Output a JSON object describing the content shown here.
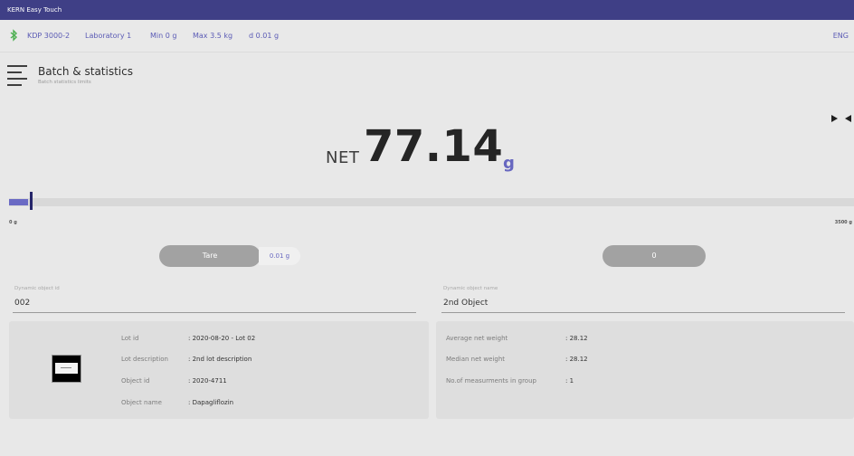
{
  "app": {
    "title": "KERN Easy Touch"
  },
  "status_bar": {
    "model": "KDP 3000-2",
    "location": "Laboratory 1",
    "min": "Min 0 g",
    "max": "Max 3.5 kg",
    "d": "d 0.01 g",
    "language": "ENG"
  },
  "page": {
    "title": "Batch & statistics",
    "subtitle": "Batch statistics limits"
  },
  "reading": {
    "net_label": "NET",
    "value": "77.14",
    "unit": "g"
  },
  "range_bar": {
    "min_label": "0 g",
    "max_label": "3500 g",
    "fill_fraction": 0.022
  },
  "buttons": {
    "tare": "Tare",
    "tare_value": "0.01 g",
    "zero": "0"
  },
  "fields": {
    "object_id": {
      "label": "Dynamic object id",
      "value": "002"
    },
    "object_name": {
      "label": "Dynamic object name",
      "value": "2nd Object"
    }
  },
  "object_details": [
    {
      "key": "Lot id",
      "value": ": 2020-08-20 - Lot 02"
    },
    {
      "key": "Lot description",
      "value": ": 2nd lot description"
    },
    {
      "key": "Object id",
      "value": ": 2020-4711"
    },
    {
      "key": "Object name",
      "value": ": Dapagliflozin"
    }
  ],
  "statistics": [
    {
      "key": "Average net weight",
      "value": ": 28.12"
    },
    {
      "key": "Median net weight",
      "value": ": 28.12"
    },
    {
      "key": "No.of measurments in group",
      "value": ": 1"
    }
  ],
  "icons": {
    "bluetooth": "bluetooth-icon",
    "menu": "hamburger-menu-icon",
    "collapse": "collapse-arrows-icon",
    "object": "object-image-icon"
  },
  "colors": {
    "accent": "#5b5bb5",
    "titlebar": "#3f3f86",
    "button": "#a2a2a2",
    "bluetooth": "#4caf50"
  }
}
